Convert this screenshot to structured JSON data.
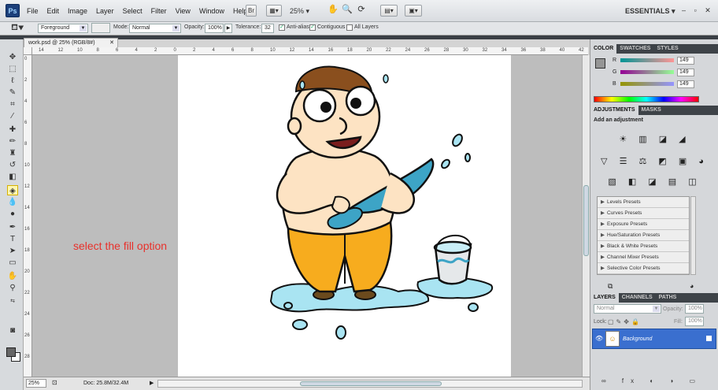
{
  "menubar": {
    "logo": "Ps",
    "menus": [
      "File",
      "Edit",
      "Image",
      "Layer",
      "Select",
      "Filter",
      "View",
      "Window",
      "Help"
    ],
    "mode_btn": "Br",
    "zoom": "25%",
    "workspace": "ESSENTIALS",
    "window_controls": "– ▫ ✕"
  },
  "options": {
    "fill_source": "Foreground",
    "mode_label": "Mode:",
    "mode_value": "Normal",
    "opacity_label": "Opacity:",
    "opacity_value": "100%",
    "tolerance_label": "Tolerance:",
    "tolerance_value": "32",
    "antialias_label": "Anti-alias",
    "contiguous_label": "Contiguous",
    "alllayers_label": "All Layers"
  },
  "document": {
    "tab_title": "work.psd @ 25% (RGB/8#)",
    "annotation": "select the fill option"
  },
  "ruler": {
    "top_ticks": [
      "14",
      "12",
      "10",
      "8",
      "6",
      "4",
      "2",
      "0",
      "2",
      "4",
      "6",
      "8",
      "10",
      "12",
      "14",
      "16",
      "18",
      "20",
      "22",
      "24",
      "26",
      "28",
      "30",
      "32",
      "34",
      "36",
      "38",
      "40",
      "42"
    ],
    "left_ticks": [
      "0",
      "2",
      "4",
      "6",
      "8",
      "10",
      "12",
      "14",
      "16",
      "18",
      "20",
      "22",
      "24",
      "26",
      "28"
    ]
  },
  "status": {
    "zoom": "25%",
    "doc": "Doc: 25.8M/32.4M"
  },
  "color_panel": {
    "tabs": [
      "COLOR",
      "SWATCHES",
      "STYLES"
    ],
    "r_label": "R",
    "g_label": "G",
    "b_label": "B",
    "r": "149",
    "g": "149",
    "b": "149"
  },
  "adjustments": {
    "tabs": [
      "ADJUSTMENTS",
      "MASKS"
    ],
    "heading": "Add an adjustment",
    "row1": "☀ ▥ ◪ ◢",
    "row2": "▽ ☰ ⚖ ◩ ▣ ◕",
    "row3": "▧ ◧ ◪ ▤ ◫",
    "presets": [
      "Levels Presets",
      "Curves Presets",
      "Exposure Presets",
      "Hue/Saturation Presets",
      "Black & White Presets",
      "Channel Mixer Presets",
      "Selective Color Presets"
    ]
  },
  "layers": {
    "tabs": [
      "LAYERS",
      "CHANNELS",
      "PATHS"
    ],
    "blend": "Normal",
    "opacity_label": "Opacity:",
    "opacity": "100%",
    "lock_label": "Lock:",
    "fill_label": "Fill:",
    "fill": "100%",
    "background_name": "Background",
    "footer_icons": "∞ fx ◐ ◑ ▭ ▯ 🗑"
  }
}
